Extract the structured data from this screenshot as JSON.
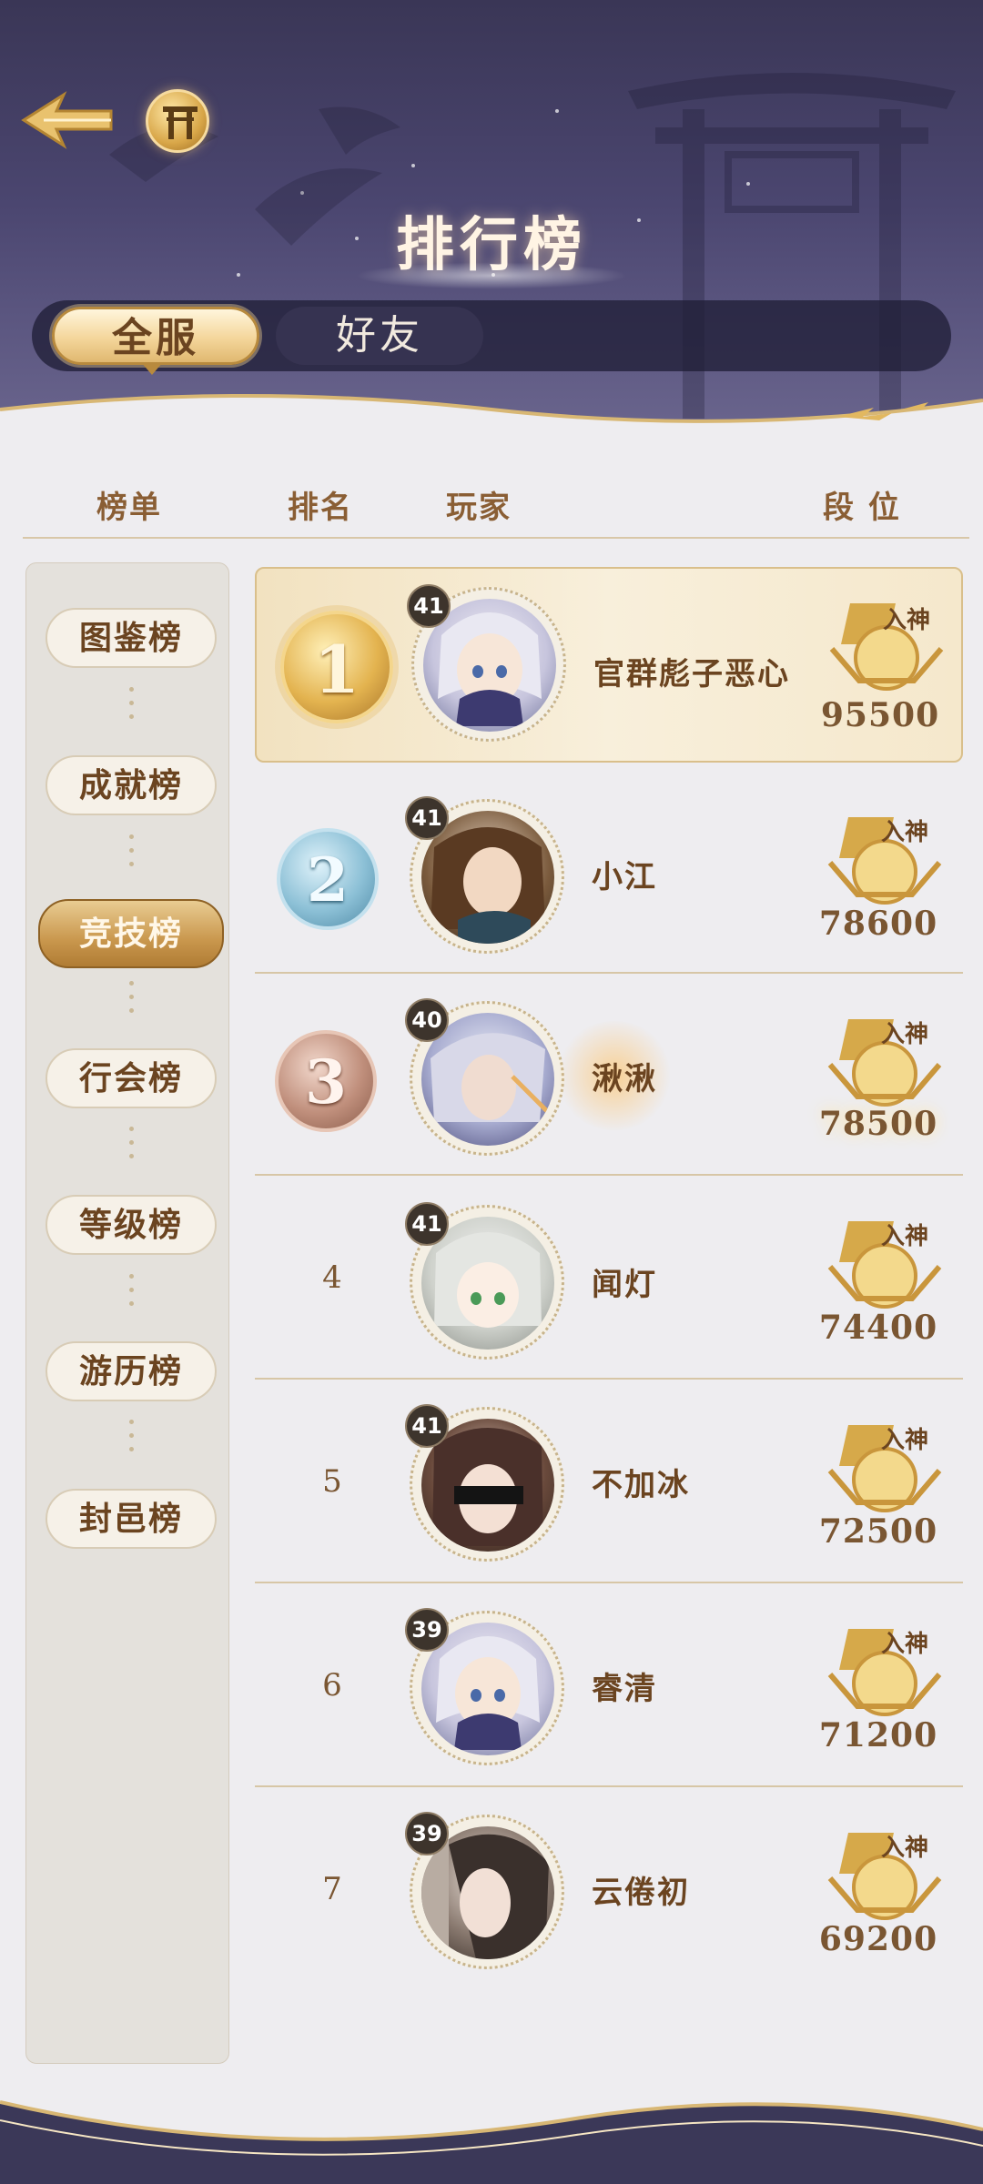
{
  "header": {
    "title": "排行榜"
  },
  "tabs": [
    {
      "label": "全服",
      "active": true
    },
    {
      "label": "好友",
      "active": false
    }
  ],
  "columns": {
    "board": "榜单",
    "rank": "排名",
    "player": "玩家",
    "tier": "段 位"
  },
  "categories": [
    {
      "label": "图鉴榜",
      "active": false
    },
    {
      "label": "成就榜",
      "active": false
    },
    {
      "label": "竞技榜",
      "active": true
    },
    {
      "label": "行会榜",
      "active": false
    },
    {
      "label": "等级榜",
      "active": false
    },
    {
      "label": "游历榜",
      "active": false
    },
    {
      "label": "封邑榜",
      "active": false
    }
  ],
  "rows": [
    {
      "rank": "1",
      "level": "41",
      "name": "官群彪子恶心",
      "tier": "入神",
      "score": "95500"
    },
    {
      "rank": "2",
      "level": "41",
      "name": "小江",
      "tier": "入神",
      "score": "78600"
    },
    {
      "rank": "3",
      "level": "40",
      "name": "湫湫",
      "tier": "入神",
      "score": "78500"
    },
    {
      "rank": "4",
      "level": "41",
      "name": "闻灯",
      "tier": "入神",
      "score": "74400"
    },
    {
      "rank": "5",
      "level": "41",
      "name": "不加冰",
      "tier": "入神",
      "score": "72500"
    },
    {
      "rank": "6",
      "level": "39",
      "name": "睿清",
      "tier": "入神",
      "score": "71200"
    },
    {
      "rank": "7",
      "level": "39",
      "name": "云倦初",
      "tier": "入神",
      "score": "69200"
    }
  ],
  "colors": {
    "gold": "#d8a648",
    "silver": "#7fb3cc",
    "bronze": "#b98a78",
    "text": "#6b4420"
  }
}
